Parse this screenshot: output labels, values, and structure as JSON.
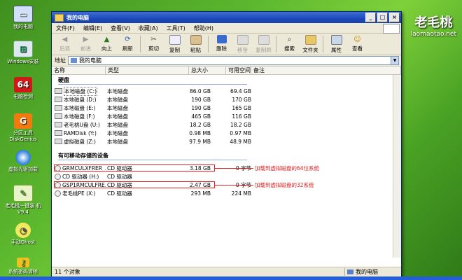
{
  "desktop": {
    "icons": [
      {
        "label": "我的电脑",
        "icon": "computer-icon"
      },
      {
        "label": "Windows安装",
        "icon": "windows-setup-icon"
      },
      {
        "label": "电脑检测",
        "icon": "pc-test-icon",
        "badge": "64"
      },
      {
        "label": "分区工具 DiskGenius",
        "icon": "diskgenius-icon",
        "badge": "G"
      },
      {
        "label": "虚拟光驱加载",
        "icon": "virtual-drive-icon"
      },
      {
        "label": "老毛桃一键装 机 V9.4",
        "icon": "installer-icon"
      },
      {
        "label": "手动Ghost",
        "icon": "ghost-icon"
      },
      {
        "label": "系统密码清除",
        "icon": "password-clear-icon"
      }
    ],
    "logo": {
      "main": "老毛桃",
      "url": "laomaotao.net"
    }
  },
  "window": {
    "title": "我的电脑",
    "controls": {
      "minimize": "_",
      "maximize": "□",
      "close": "×"
    },
    "menu": [
      "文件(F)",
      "编辑(E)",
      "查看(V)",
      "收藏(A)",
      "工具(T)",
      "帮助(H)"
    ],
    "toolbar": [
      {
        "label": "后退",
        "icon": "back-arrow-icon",
        "enabled": false
      },
      {
        "label": "前进",
        "icon": "forward-arrow-icon",
        "enabled": false
      },
      {
        "label": "向上",
        "icon": "up-arrow-icon",
        "enabled": true
      },
      {
        "label": "刷新",
        "icon": "refresh-icon",
        "enabled": true
      },
      {
        "label": "剪切",
        "icon": "cut-icon",
        "enabled": true
      },
      {
        "label": "复制",
        "icon": "copy-icon",
        "enabled": true
      },
      {
        "label": "粘贴",
        "icon": "paste-icon",
        "enabled": true
      },
      {
        "label": "删除",
        "icon": "delete-icon",
        "enabled": true
      },
      {
        "label": "移至",
        "icon": "move-to-icon",
        "enabled": false
      },
      {
        "label": "复制到",
        "icon": "copy-to-icon",
        "enabled": false
      },
      {
        "label": "搜索",
        "icon": "search-icon",
        "enabled": true
      },
      {
        "label": "文件夹",
        "icon": "folders-icon",
        "enabled": true
      },
      {
        "label": "属性",
        "icon": "properties-icon",
        "enabled": true
      },
      {
        "label": "查看",
        "icon": "views-icon",
        "enabled": true
      }
    ],
    "address": {
      "label": "地址",
      "value": "我的电脑"
    },
    "columns": [
      "名称",
      "类型",
      "总大小",
      "可用空间",
      "备注"
    ],
    "groups": {
      "hard_disks": "硬盘",
      "removable": "有可移动存储的设备"
    },
    "hard_disks": [
      {
        "name": "本地磁盘 (C:)",
        "type": "本地磁盘",
        "total": "86.0 GB",
        "free": "69.4 GB"
      },
      {
        "name": "本地磁盘 (D:)",
        "type": "本地磁盘",
        "total": "190 GB",
        "free": "170 GB"
      },
      {
        "name": "本地磁盘 (E:)",
        "type": "本地磁盘",
        "total": "190 GB",
        "free": "165 GB"
      },
      {
        "name": "本地磁盘 (F:)",
        "type": "本地磁盘",
        "total": "465 GB",
        "free": "116 GB"
      },
      {
        "name": "老毛桃U盘 (U:)",
        "type": "本地磁盘",
        "total": "18.2 GB",
        "free": "18.2 GB"
      },
      {
        "name": "RAMDisk (Y:)",
        "type": "本地磁盘",
        "total": "0.98 MB",
        "free": "0.97 MB"
      },
      {
        "name": "虚拟磁盘 (Z:)",
        "type": "本地磁盘",
        "total": "97.9 MB",
        "free": "48.9 MB"
      }
    ],
    "removable": [
      {
        "name": "GRMCULXFRER_...",
        "type": "CD 驱动器",
        "total": "3.18 GB",
        "free": "0 字节"
      },
      {
        "name": "CD 驱动器 (H:)",
        "type": "CD 驱动器",
        "total": "",
        "free": ""
      },
      {
        "name": "GSP1RMCULFRE...",
        "type": "CD 驱动器",
        "total": "2.47 GB",
        "free": "0 字节"
      },
      {
        "name": "老毛桃PE (X:)",
        "type": "CD 驱动器",
        "total": "293 MB",
        "free": "224 MB"
      }
    ],
    "annotations": [
      "加载到虚拟磁盘的64位系统",
      "加载到虚拟磁盘的32系统"
    ],
    "status": {
      "count": "11 个对象",
      "location": "我的电脑"
    }
  }
}
